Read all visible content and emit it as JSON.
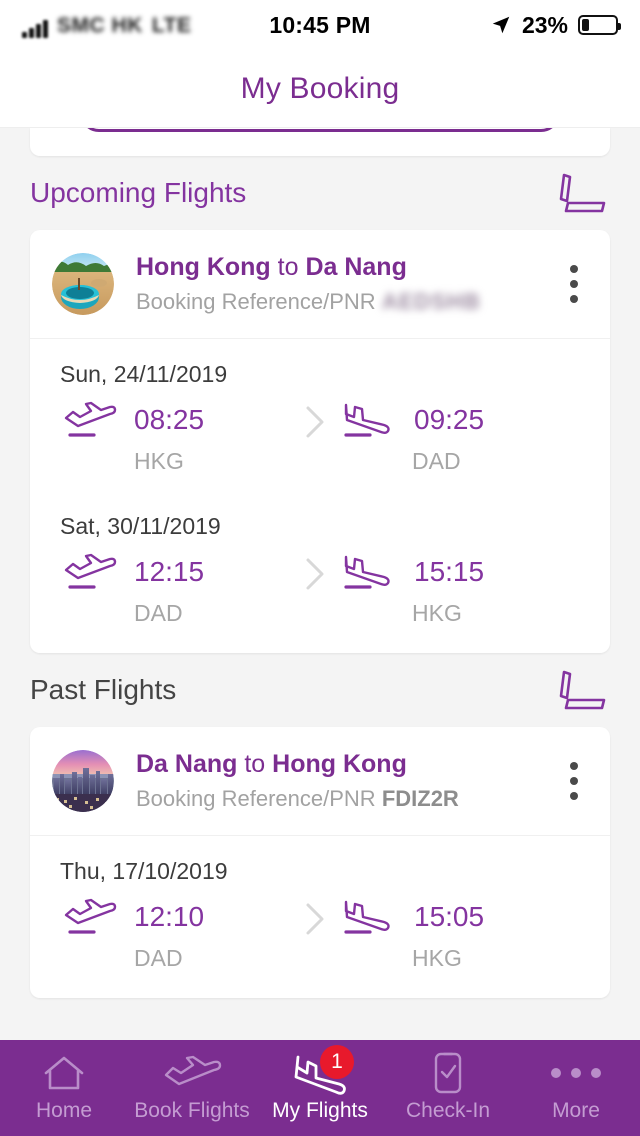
{
  "status_bar": {
    "carrier": "SMC HK",
    "network": "LTE",
    "time": "10:45 PM",
    "battery_percent": "23%",
    "location_icon": "location-arrow-icon"
  },
  "header": {
    "title": "My Booking"
  },
  "sections": [
    {
      "title": "Upcoming Flights",
      "icon": "airplane-seat-icon",
      "bookings": [
        {
          "avatar": "da-nang-beach-photo",
          "from_city": "Hong Kong",
          "connector": " to ",
          "to_city": "Da Nang",
          "pnr_label": "Booking Reference/PNR",
          "pnr_value": "AEDSHB",
          "pnr_redacted": true,
          "menu_icon": "overflow-menu-icon",
          "segments": [
            {
              "date": "Sun, 24/11/2019",
              "depart_time": "08:25",
              "depart_code": "HKG",
              "arrive_time": "09:25",
              "arrive_code": "DAD"
            },
            {
              "date": "Sat, 30/11/2019",
              "depart_time": "12:15",
              "depart_code": "DAD",
              "arrive_time": "15:15",
              "arrive_code": "HKG"
            }
          ]
        }
      ]
    },
    {
      "title": "Past Flights",
      "icon": "airplane-seat-icon",
      "bookings": [
        {
          "avatar": "hong-kong-skyline-photo",
          "from_city": "Da Nang",
          "connector": " to ",
          "to_city": "Hong Kong",
          "pnr_label": "Booking Reference/PNR",
          "pnr_value": "FDIZ2R",
          "pnr_redacted": false,
          "menu_icon": "overflow-menu-icon",
          "segments": [
            {
              "date": "Thu, 17/10/2019",
              "depart_time": "12:10",
              "depart_code": "DAD",
              "arrive_time": "15:05",
              "arrive_code": "HKG"
            }
          ]
        }
      ]
    }
  ],
  "tabbar": {
    "items": [
      {
        "label": "Home",
        "icon": "home-icon",
        "active": false
      },
      {
        "label": "Book Flights",
        "icon": "airplane-icon",
        "active": false
      },
      {
        "label": "My Flights",
        "icon": "airplane-tilted-icon",
        "active": true,
        "badge": "1"
      },
      {
        "label": "Check-In",
        "icon": "mobile-check-icon",
        "active": false
      },
      {
        "label": "More",
        "icon": "ellipsis-icon",
        "active": false
      }
    ]
  },
  "colors": {
    "brand_purple": "#7b2d90",
    "accent_purple": "#8434a0",
    "badge_red": "#e8192c",
    "muted_gray": "#a6a6a6",
    "page_bg": "#f4f4f4"
  }
}
